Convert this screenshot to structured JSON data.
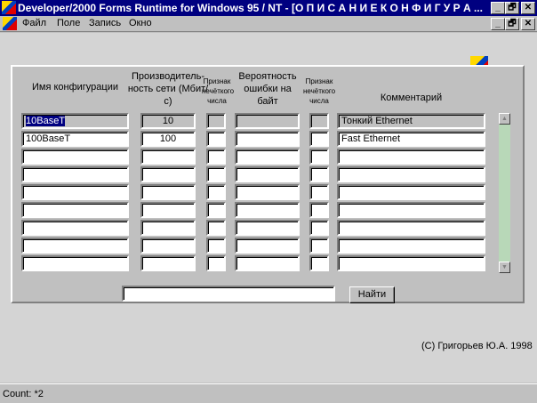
{
  "window": {
    "title": "Developer/2000 Forms Runtime for Windows 95 / NT - [О П И С А Н И Е    К О Н Ф И Г У Р А ...",
    "minimize": "_",
    "restore": "🗗",
    "close": "✕"
  },
  "menu": [
    "Файл",
    "Поле",
    "Запись",
    "Окно"
  ],
  "headers": {
    "name": "Имя конфигурации",
    "perf": "Производитель-ность сети (Мбит/с)",
    "flag1": "Признак нечёткого числа",
    "prob": "Вероятность ошибки на байт",
    "flag2": "Признак нечёткого числа",
    "comment": "Комментарий"
  },
  "rows": [
    {
      "name": "10BaseT",
      "perf": "10",
      "flag1": "",
      "prob": "",
      "flag2": "",
      "comment": "Тонкий Ethernet"
    },
    {
      "name": "100BaseT",
      "perf": "100",
      "flag1": "",
      "prob": "",
      "flag2": "",
      "comment": "Fast Ethernet"
    },
    {
      "name": "",
      "perf": "",
      "flag1": "",
      "prob": "",
      "flag2": "",
      "comment": ""
    },
    {
      "name": "",
      "perf": "",
      "flag1": "",
      "prob": "",
      "flag2": "",
      "comment": ""
    },
    {
      "name": "",
      "perf": "",
      "flag1": "",
      "prob": "",
      "flag2": "",
      "comment": ""
    },
    {
      "name": "",
      "perf": "",
      "flag1": "",
      "prob": "",
      "flag2": "",
      "comment": ""
    },
    {
      "name": "",
      "perf": "",
      "flag1": "",
      "prob": "",
      "flag2": "",
      "comment": ""
    },
    {
      "name": "",
      "perf": "",
      "flag1": "",
      "prob": "",
      "flag2": "",
      "comment": ""
    },
    {
      "name": "",
      "perf": "",
      "flag1": "",
      "prob": "",
      "flag2": "",
      "comment": ""
    }
  ],
  "search": {
    "value": "",
    "button": "Найти"
  },
  "copyright": "(С) Григорьев Ю.А. 1998",
  "status": "Count: *2"
}
